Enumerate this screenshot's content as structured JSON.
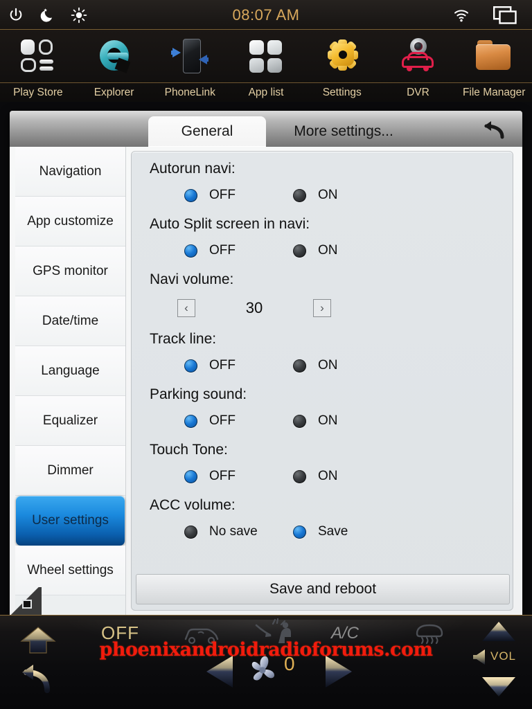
{
  "statusbar": {
    "time": "08:07 AM",
    "icons_left": [
      "power-icon",
      "night-mode-icon",
      "brightness-icon"
    ],
    "icons_right": [
      "wifi-icon",
      "screen-cast-icon"
    ]
  },
  "launcher": {
    "apps": [
      {
        "label": "Play Store",
        "icon": "play-store-icon"
      },
      {
        "label": "Explorer",
        "icon": "explorer-icon"
      },
      {
        "label": "PhoneLink",
        "icon": "phonelink-icon"
      },
      {
        "label": "App list",
        "icon": "app-list-icon"
      },
      {
        "label": "Settings",
        "icon": "settings-gear-icon"
      },
      {
        "label": "DVR",
        "icon": "dvr-camera-car-icon"
      },
      {
        "label": "File Manager",
        "icon": "folder-icon"
      }
    ]
  },
  "window": {
    "tabs": [
      {
        "label": "General",
        "active": true
      },
      {
        "label": "More settings...",
        "active": false
      }
    ],
    "back_icon": "back-undo-icon"
  },
  "sidebar": {
    "items": [
      {
        "label": "Navigation",
        "active": false
      },
      {
        "label": "App customize",
        "active": false
      },
      {
        "label": "GPS monitor",
        "active": false
      },
      {
        "label": "Date/time",
        "active": false
      },
      {
        "label": "Language",
        "active": false
      },
      {
        "label": "Equalizer",
        "active": false
      },
      {
        "label": "Dimmer",
        "active": false
      },
      {
        "label": "User settings",
        "active": true
      },
      {
        "label": "Wheel settings",
        "active": false
      }
    ]
  },
  "settings": {
    "autorun_navi": {
      "label": "Autorun navi:",
      "options": [
        "OFF",
        "ON"
      ],
      "selected": "OFF"
    },
    "auto_split": {
      "label": "Auto Split screen in navi:",
      "options": [
        "OFF",
        "ON"
      ],
      "selected": "OFF"
    },
    "navi_volume": {
      "label": "Navi volume:",
      "value": "30",
      "dec": "‹",
      "inc": "›"
    },
    "track_line": {
      "label": "Track line:",
      "options": [
        "OFF",
        "ON"
      ],
      "selected": "OFF"
    },
    "parking_sound": {
      "label": "Parking sound:",
      "options": [
        "OFF",
        "ON"
      ],
      "selected": "OFF"
    },
    "touch_tone": {
      "label": "Touch Tone:",
      "options": [
        "OFF",
        "ON"
      ],
      "selected": "OFF"
    },
    "acc_volume": {
      "label": "ACC volume:",
      "options": [
        "No save",
        "Save"
      ],
      "selected": "Save"
    },
    "save_button": "Save and reboot"
  },
  "bottombar": {
    "mode": "OFF",
    "ac_label": "A/C",
    "fan_value": "0",
    "vol_label": "VOL",
    "watermark": "phoenixandroidradioforums.com",
    "icons": [
      "home-icon",
      "back-icon",
      "rear-defrost-icon",
      "seat-airflow-icon",
      "front-defrost-icon",
      "fan-left-arrow",
      "fan-icon",
      "fan-right-arrow",
      "volume-up-icon",
      "volume-down-icon",
      "speaker-icon"
    ]
  },
  "colors": {
    "accent_gold": "#d8a85c",
    "active_blue": "#1b8ade",
    "radio_on": "#1877d4",
    "watermark_red": "#f21b0c"
  }
}
